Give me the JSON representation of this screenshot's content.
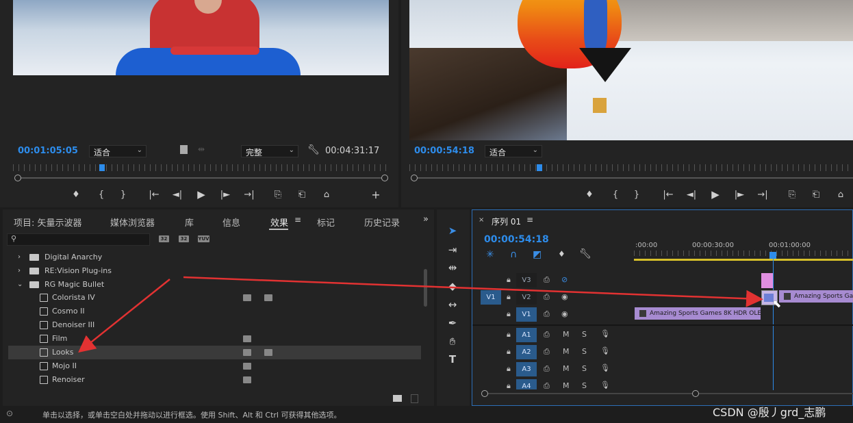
{
  "source_monitor": {
    "timecode": "00:01:05:05",
    "zoom": "适合",
    "quality": "完整",
    "duration": "00:04:31:17",
    "controls": [
      "♦",
      "{",
      "}",
      "|←",
      "◄|",
      "▶",
      "|►",
      "→|",
      "⎘",
      "⎗",
      "⌂",
      "+"
    ]
  },
  "program_monitor": {
    "timecode": "00:00:54:18",
    "zoom": "适合",
    "controls": [
      "♦",
      "{",
      "}",
      "|←",
      "◄|",
      "▶",
      "|►",
      "→|",
      "⎘",
      "⎗",
      "⌂"
    ]
  },
  "effects_panel": {
    "tabs": [
      "项目: 矢量示波器",
      "媒体浏览器",
      "库",
      "信息",
      "效果",
      "标记",
      "历史记录"
    ],
    "active_tab": "效果",
    "search_placeholder": "",
    "filter_badges": [
      "32",
      "32",
      "YUV"
    ],
    "tree": [
      {
        "label": "Digital Anarchy",
        "type": "folder",
        "expanded": false
      },
      {
        "label": "RE:Vision Plug-ins",
        "type": "folder",
        "expanded": false
      },
      {
        "label": "RG Magic Bullet",
        "type": "folder",
        "expanded": true
      },
      {
        "label": "Colorista IV",
        "type": "preset",
        "badges": 2
      },
      {
        "label": "Cosmo II",
        "type": "preset",
        "badges": 0
      },
      {
        "label": "Denoiser III",
        "type": "preset",
        "badges": 0
      },
      {
        "label": "Film",
        "type": "preset",
        "badges": 1
      },
      {
        "label": "Looks",
        "type": "preset",
        "badges": 2,
        "selected": true
      },
      {
        "label": "Mojo II",
        "type": "preset",
        "badges": 1
      },
      {
        "label": "Renoiser",
        "type": "preset",
        "badges": 1
      }
    ]
  },
  "timeline": {
    "sequence_name": "序列 01",
    "timecode": "00:00:54:18",
    "ruler_labels": [
      ":00:00",
      "00:00:30:00",
      "00:01:00:00"
    ],
    "video_tracks": [
      "V3",
      "V2",
      "V1"
    ],
    "audio_tracks": [
      "A1",
      "A2",
      "A3",
      "A4"
    ],
    "source_patch_video": "V1",
    "clips": {
      "v1_clip": "Amazing Sports Games 8K HDR OLE",
      "v2_clip": "Amazing Sports Gam"
    },
    "track_M": "M",
    "track_S": "S"
  },
  "status_bar": {
    "hint": "单击以选择，或单击空白处并拖动以进行框选。使用 Shift、Alt 和 Ctrl 可获得其他选项。"
  },
  "watermark": "CSDN @殷丿grd_志鹏",
  "colors": {
    "timecode_blue": "#2d8ceb",
    "track_blue": "#2a5b8c",
    "clip_purple": "#a78bd1",
    "clip_pink": "#e08ee0",
    "arrow_red": "#e23232"
  }
}
